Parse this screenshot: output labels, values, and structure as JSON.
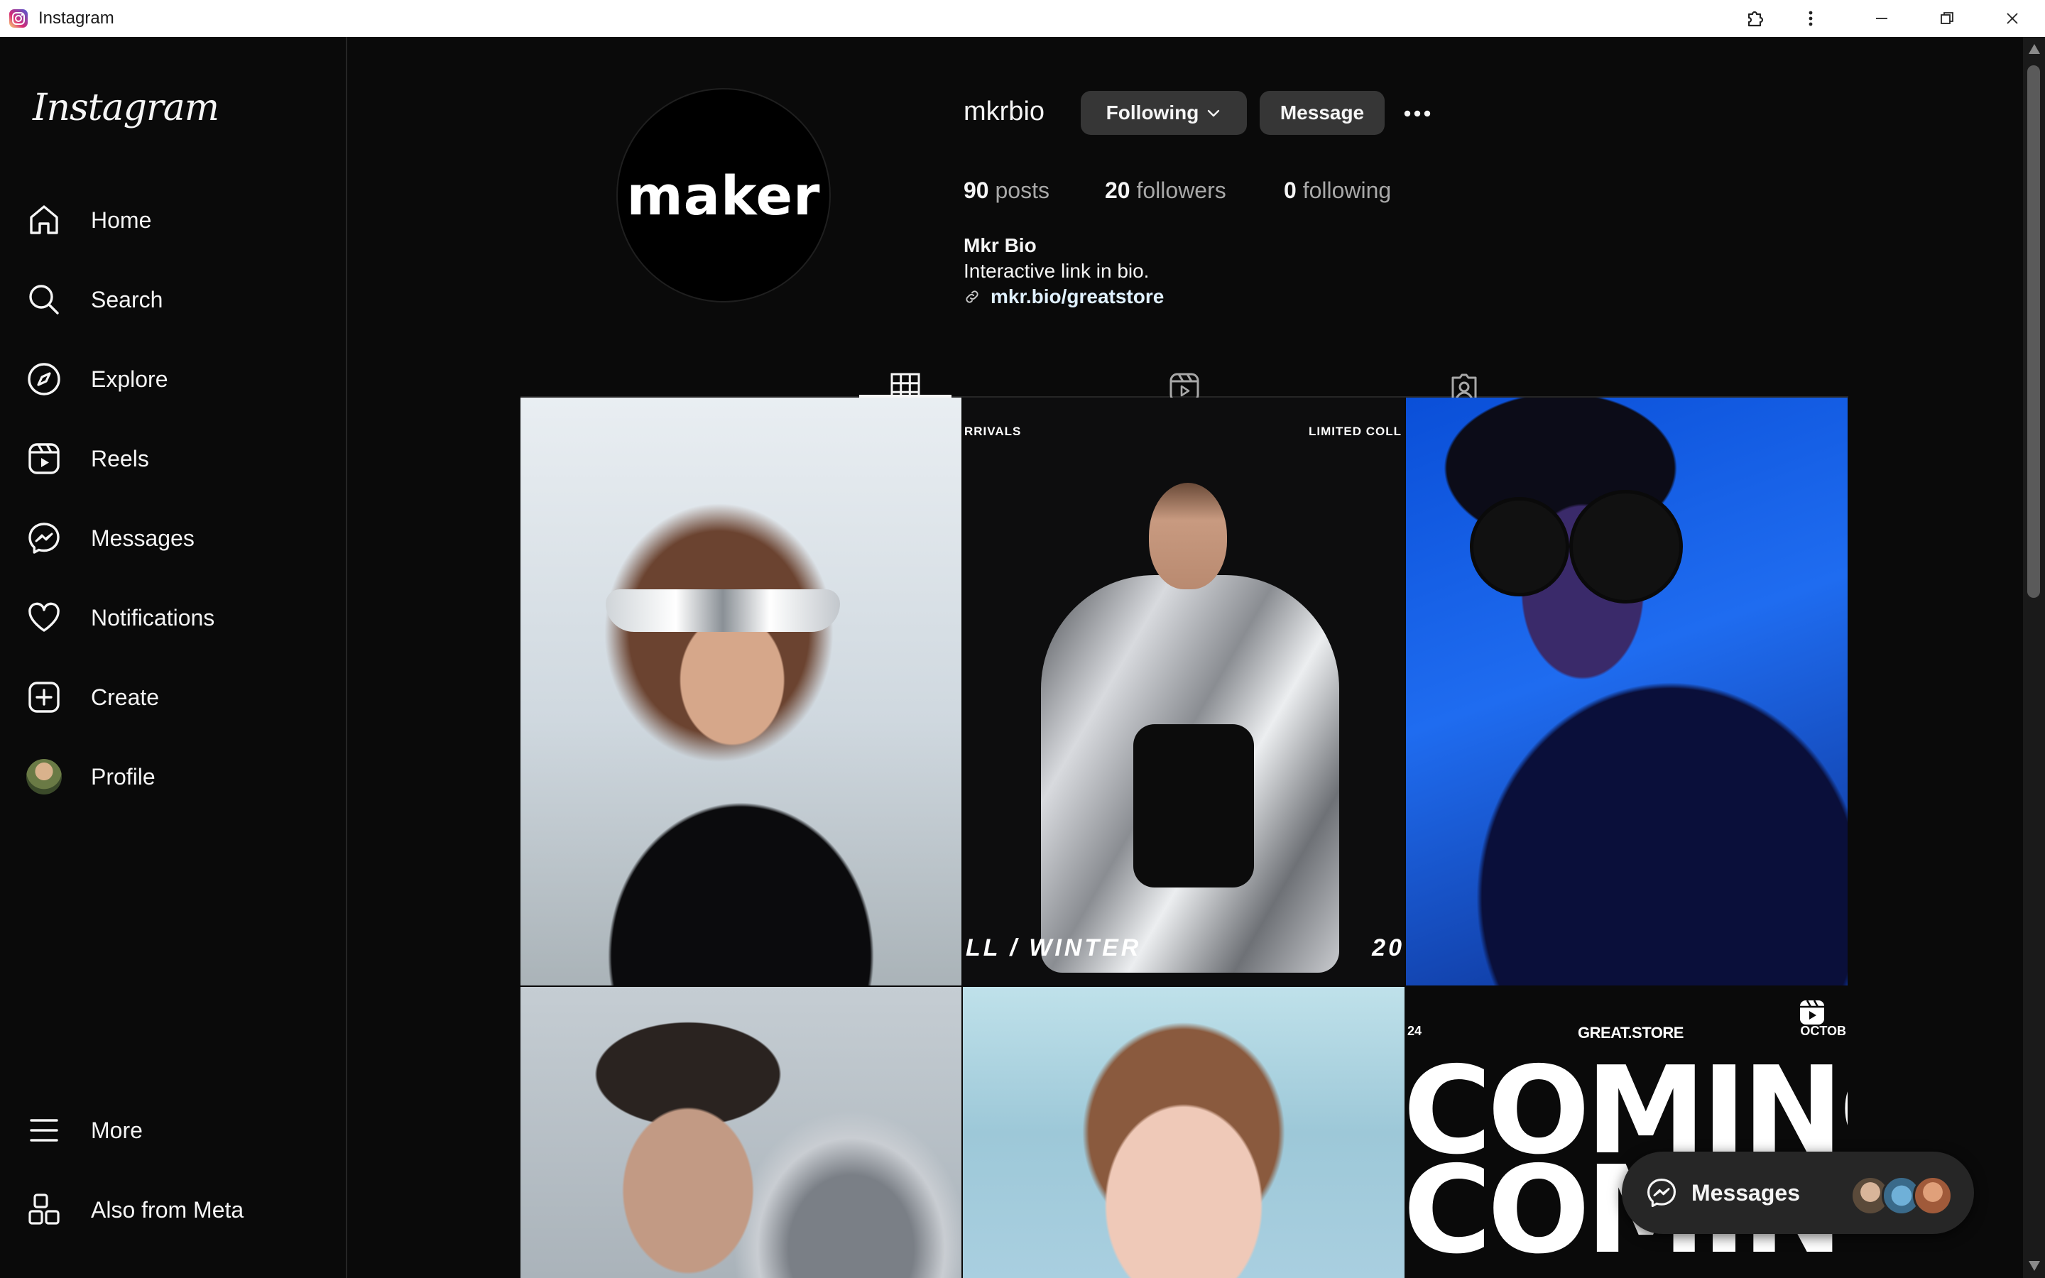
{
  "window": {
    "title": "Instagram",
    "icons": [
      "instagram-app-icon",
      "extension-icon",
      "kebab-menu-icon",
      "minimize-icon",
      "restore-icon",
      "close-icon"
    ]
  },
  "sidebar": {
    "logo": "Instagram",
    "items": [
      {
        "label": "Home",
        "icon": "home-icon"
      },
      {
        "label": "Search",
        "icon": "search-icon"
      },
      {
        "label": "Explore",
        "icon": "compass-icon"
      },
      {
        "label": "Reels",
        "icon": "reels-icon"
      },
      {
        "label": "Messages",
        "icon": "messenger-icon"
      },
      {
        "label": "Notifications",
        "icon": "heart-icon"
      },
      {
        "label": "Create",
        "icon": "plus-square-icon"
      },
      {
        "label": "Profile",
        "icon": "avatar"
      }
    ],
    "bottom": [
      {
        "label": "More",
        "icon": "hamburger-icon"
      },
      {
        "label": "Also from Meta",
        "icon": "meta-apps-icon"
      }
    ]
  },
  "profile": {
    "avatar_text": "maker",
    "username": "mkrbio",
    "following_button": "Following",
    "message_button": "Message",
    "stats": {
      "posts_count": "90",
      "posts_label": "posts",
      "followers_count": "20",
      "followers_label": "followers",
      "following_count": "0",
      "following_label": "following"
    },
    "full_name": "Mkr Bio",
    "bio": "Interactive link in bio.",
    "link": "mkr.bio/greatstore"
  },
  "tabs": [
    {
      "name": "posts-grid",
      "icon": "grid-icon",
      "active": true
    },
    {
      "name": "reels",
      "icon": "reels-icon",
      "active": false
    },
    {
      "name": "tagged",
      "icon": "tagged-icon",
      "active": false
    }
  ],
  "posts": {
    "post2_top_left": "RRIVALS",
    "post2_top_right": "LIMITED COLL",
    "post2_bottom_left": "LL / WINTER",
    "post2_bottom_right": "20",
    "post6_top_left": "24",
    "post6_top_center": "GREAT.STORE",
    "post6_top_right": "OCTOB",
    "post6_big_line1": "COMING",
    "post6_big_line2": "COMING"
  },
  "messages_pill": {
    "label": "Messages"
  },
  "colors": {
    "background": "#0a0a0a",
    "button": "#363636",
    "link": "#e0f1ff",
    "muted": "#a8a8a8"
  }
}
